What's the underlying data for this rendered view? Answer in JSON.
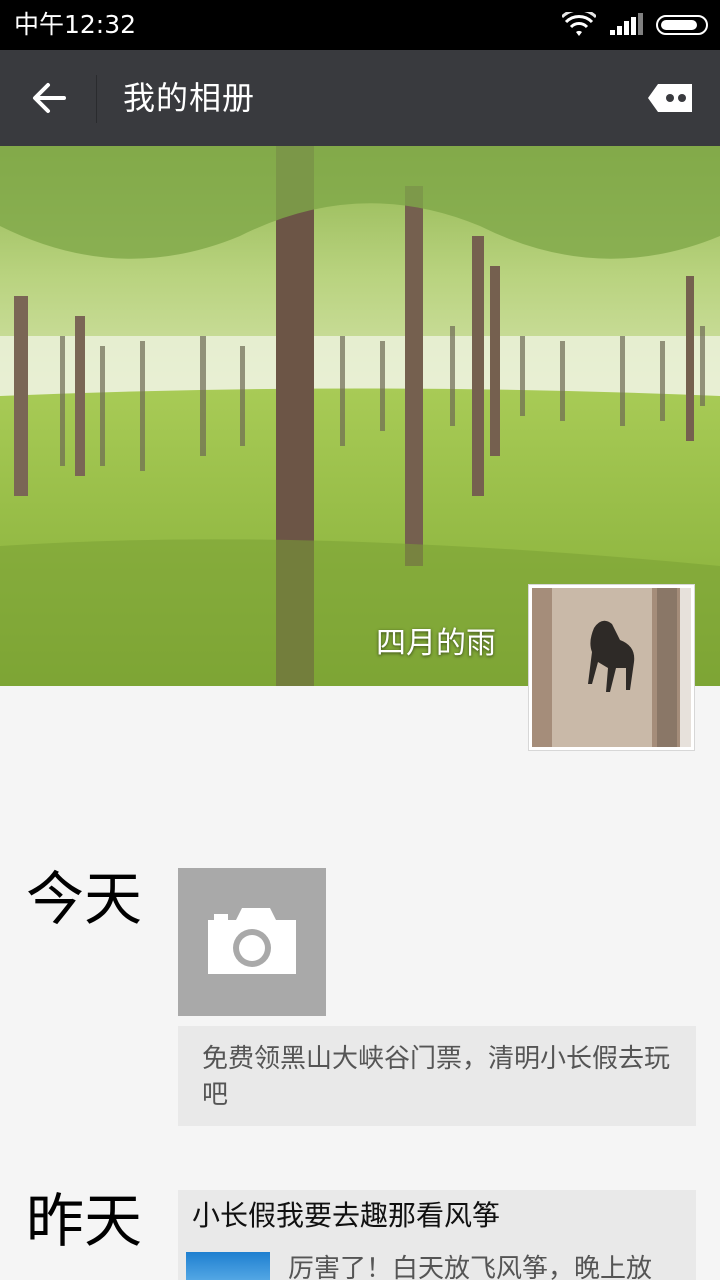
{
  "status_bar": {
    "time": "中午12:32"
  },
  "header": {
    "title": "我的相册"
  },
  "profile": {
    "nickname": "四月的雨"
  },
  "timeline": {
    "today": {
      "label": "今天",
      "post_text": "免费领黑山大峡谷门票，清明小长假去玩吧"
    },
    "yesterday": {
      "label": "昨天",
      "card_title": "小长假我要去趣那看风筝",
      "card_desc": "厉害了！白天放飞风筝，晚上放"
    }
  },
  "colors": {
    "status_bar_bg": "#000000",
    "title_bar_bg": "#393a3e",
    "page_bg": "#f5f5f5",
    "card_bg": "#e9e9e9",
    "camera_tile_bg": "#a9a9a9"
  },
  "icons": {
    "back": "arrow-left-icon",
    "message": "message-icon",
    "camera": "camera-icon",
    "wifi": "wifi-icon",
    "signal": "signal-icon",
    "battery": "battery-icon"
  }
}
